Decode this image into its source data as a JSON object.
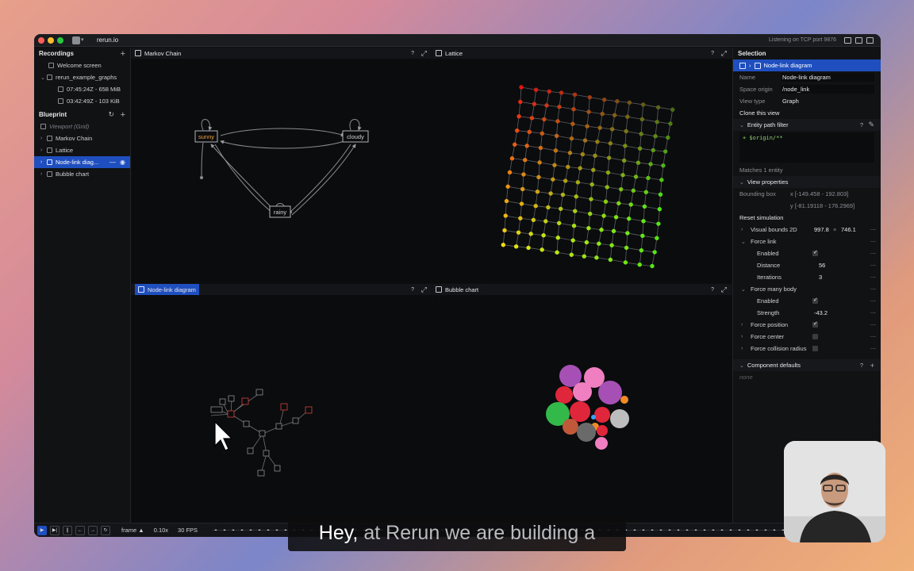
{
  "app": {
    "name": "rerun.io",
    "status": "Listening on TCP port 9876"
  },
  "recordings": {
    "title": "Recordings",
    "items": [
      {
        "label": "Welcome screen"
      },
      {
        "label": "rerun_example_graphs"
      },
      {
        "label": "07:45:24Z - 658 MiB"
      },
      {
        "label": "03:42:49Z - 103 KiB"
      }
    ]
  },
  "blueprint": {
    "title": "Blueprint",
    "viewport": "Viewport (Grid)",
    "items": [
      {
        "label": "Markov Chain"
      },
      {
        "label": "Lattice"
      },
      {
        "label": "Node-link diag..."
      },
      {
        "label": "Bubble chart"
      }
    ]
  },
  "views": {
    "markov": {
      "title": "Markov Chain",
      "help": "?",
      "nodes": [
        "sunny",
        "cloudy",
        "rainy"
      ]
    },
    "lattice": {
      "title": "Lattice",
      "help": "?"
    },
    "nodelink": {
      "title": "Node-link diagram",
      "help": "?"
    },
    "bubble": {
      "title": "Bubble chart",
      "help": "?"
    }
  },
  "selection": {
    "title": "Selection",
    "selected": "Node-link diagram",
    "name_label": "Name",
    "name_value": "Node-link diagram",
    "origin_label": "Space origin",
    "origin_value": "/node_link",
    "type_label": "View type",
    "type_value": "Graph",
    "clone": "Clone this view",
    "filter_title": "Entity path filter",
    "filter_help": "?",
    "filter_expr": "+ $origin/**",
    "matches": "Matches 1 entity",
    "view_props": "View properties",
    "bbox_label": "Bounding box",
    "bbox_x": "x [-149.458 - 192.803]",
    "bbox_y": "y [-81.19118 - 176.2969]",
    "reset": "Reset simulation",
    "props": {
      "visual_bounds": {
        "label": "Visual bounds 2D",
        "w": "997.8",
        "x": "×",
        "h": "746.1"
      },
      "force_link": "Force link",
      "fl_enabled": "Enabled",
      "fl_distance": "Distance",
      "fl_distance_v": "56",
      "fl_iterations": "Iterations",
      "fl_iterations_v": "3",
      "force_many": "Force many body",
      "fm_enabled": "Enabled",
      "fm_strength": "Strength",
      "fm_strength_v": "-43.2",
      "force_position": "Force position",
      "force_center": "Force center",
      "force_collision": "Force collision radius"
    },
    "defaults_title": "Component defaults",
    "defaults_help": "?",
    "defaults_none": "none",
    "dots": "⋯"
  },
  "timeline": {
    "timeline_name": "frame ▲",
    "speed": "0.10x",
    "fps": "30 FPS"
  },
  "caption": {
    "main": "Hey,",
    "rest": "at Rerun we are building a"
  },
  "colors": {
    "accent": "#1f4fbf",
    "sunny": "#f0a040"
  }
}
